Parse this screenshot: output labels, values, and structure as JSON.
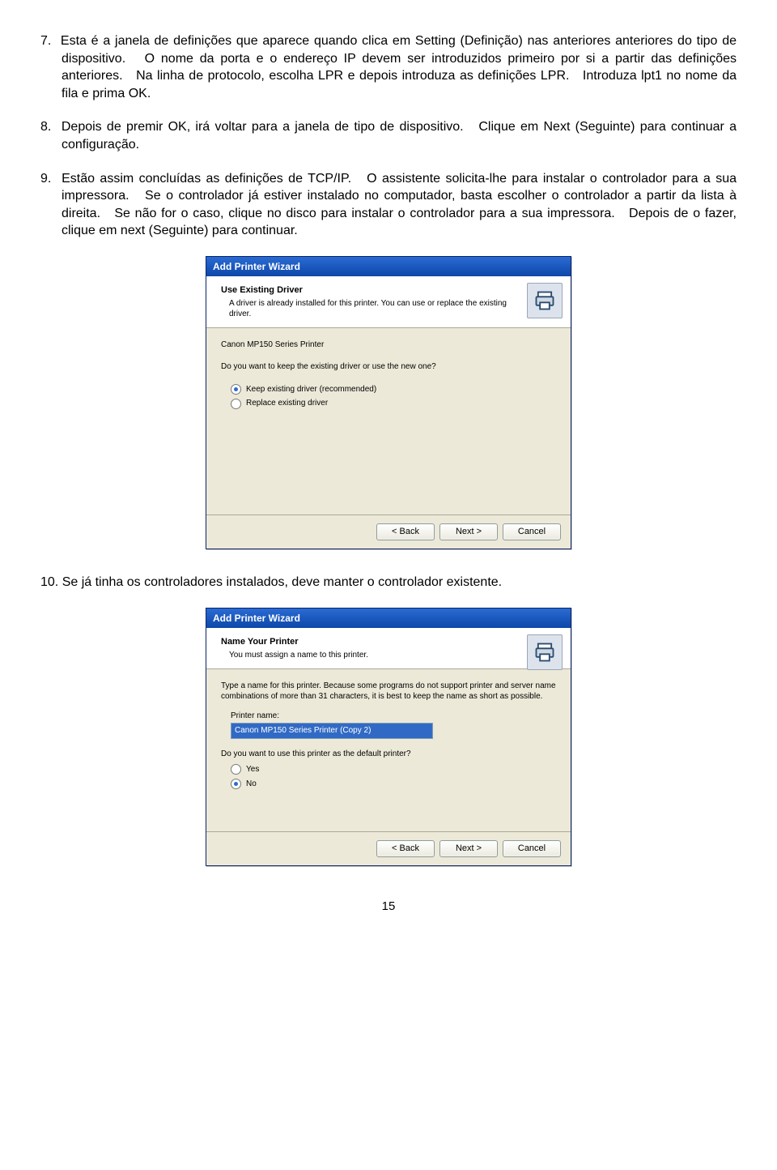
{
  "paragraphs": {
    "p7": "7.  Esta é a janela de definições que aparece quando clica em Setting (Definição) nas anteriores anteriores do tipo de dispositivo.   O nome da porta e o endereço IP devem ser introduzidos primeiro por si a partir das definições anteriores.   Na linha de protocolo, escolha LPR e depois introduza as definições LPR.   Introduza lpt1 no nome da fila e prima OK.",
    "p8": "8.  Depois de premir OK, irá voltar para a janela de tipo de dispositivo.   Clique em Next (Seguinte) para continuar a configuração.",
    "p9": "9.  Estão assim concluídas as definições de TCP/IP.   O assistente solicita-lhe para instalar o controlador para a sua impressora.   Se o controlador já estiver instalado no computador, basta escolher o controlador a partir da lista à direita.   Se não for o caso, clique no disco para instalar o controlador para a sua impressora.   Depois de o fazer, clique em next (Seguinte) para continuar.",
    "p10": "10. Se já tinha os controladores instalados, deve manter o controlador existente."
  },
  "dialog1": {
    "title": "Add Printer Wizard",
    "header_title": "Use Existing Driver",
    "header_sub": "A driver is already installed for this printer. You can use or replace the existing driver.",
    "driver_name": "Canon MP150 Series Printer",
    "question": "Do you want to keep the existing driver or use the new one?",
    "opt_keep": "Keep existing driver (recommended)",
    "opt_replace": "Replace existing driver",
    "btn_back": "< Back",
    "btn_next": "Next >",
    "btn_cancel": "Cancel"
  },
  "dialog2": {
    "title": "Add Printer Wizard",
    "header_title": "Name Your Printer",
    "header_sub": "You must assign a name to this printer.",
    "instructions": "Type a name for this printer. Because some programs do not support printer and server name combinations of more than 31 characters, it is best to keep the name as short as possible.",
    "field_label": "Printer name:",
    "field_value": "Canon MP150 Series Printer (Copy 2)",
    "default_question": "Do you want to use this printer as the default printer?",
    "opt_yes": "Yes",
    "opt_no": "No",
    "btn_back": "< Back",
    "btn_next": "Next >",
    "btn_cancel": "Cancel"
  },
  "page_number": "15"
}
